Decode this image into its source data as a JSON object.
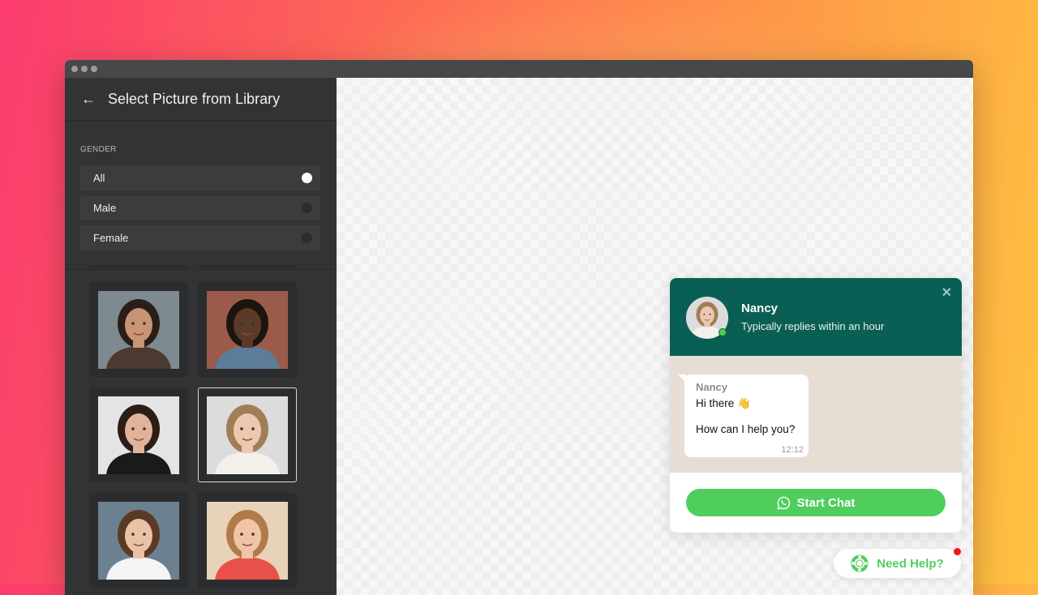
{
  "window": {
    "title": "Select Picture from Library"
  },
  "sidebar": {
    "back_icon": "arrow-left-icon",
    "gender_label": "GENDER",
    "options": [
      {
        "label": "All",
        "selected": true
      },
      {
        "label": "Male",
        "selected": false
      },
      {
        "label": "Female",
        "selected": false
      }
    ],
    "photos": [
      {
        "bg": "#7d8a90",
        "skin": "#c99476",
        "hair": "#2a1e18",
        "shirt": "#4a3a30",
        "selected": false
      },
      {
        "bg": "#9c5b4a",
        "skin": "#5b3a2a",
        "hair": "#1c140f",
        "shirt": "#5d7c9a",
        "selected": false
      },
      {
        "bg": "#e4e4e4",
        "skin": "#e0b49a",
        "hair": "#2b1d17",
        "shirt": "#1a1a1a",
        "selected": false
      },
      {
        "bg": "#dcdcdc",
        "skin": "#ecc8b0",
        "hair": "#a07e56",
        "shirt": "#f3f0ec",
        "selected": true
      },
      {
        "bg": "#6b8190",
        "skin": "#eac3a6",
        "hair": "#5a3a26",
        "shirt": "#f4f4f4",
        "selected": false
      },
      {
        "bg": "#e9d3b8",
        "skin": "#f0c5a7",
        "hair": "#b07a4a",
        "shirt": "#e8504a",
        "selected": false
      }
    ]
  },
  "widget": {
    "name": "Nancy",
    "status": "Typically replies within an hour",
    "close_icon": "close-icon",
    "message": {
      "sender": "Nancy",
      "line1": "Hi there 👋",
      "line2": "How can I help you?",
      "time": "12:12"
    },
    "start_chat_label": "Start Chat",
    "start_chat_icon": "whatsapp-icon"
  },
  "help_button": {
    "label": "Need Help?",
    "icon": "lifebuoy-icon",
    "notification": true
  },
  "colors": {
    "header": "#0a5f54",
    "accent": "#4fce5d",
    "sidebar": "#323334",
    "notification": "#f0161a"
  }
}
